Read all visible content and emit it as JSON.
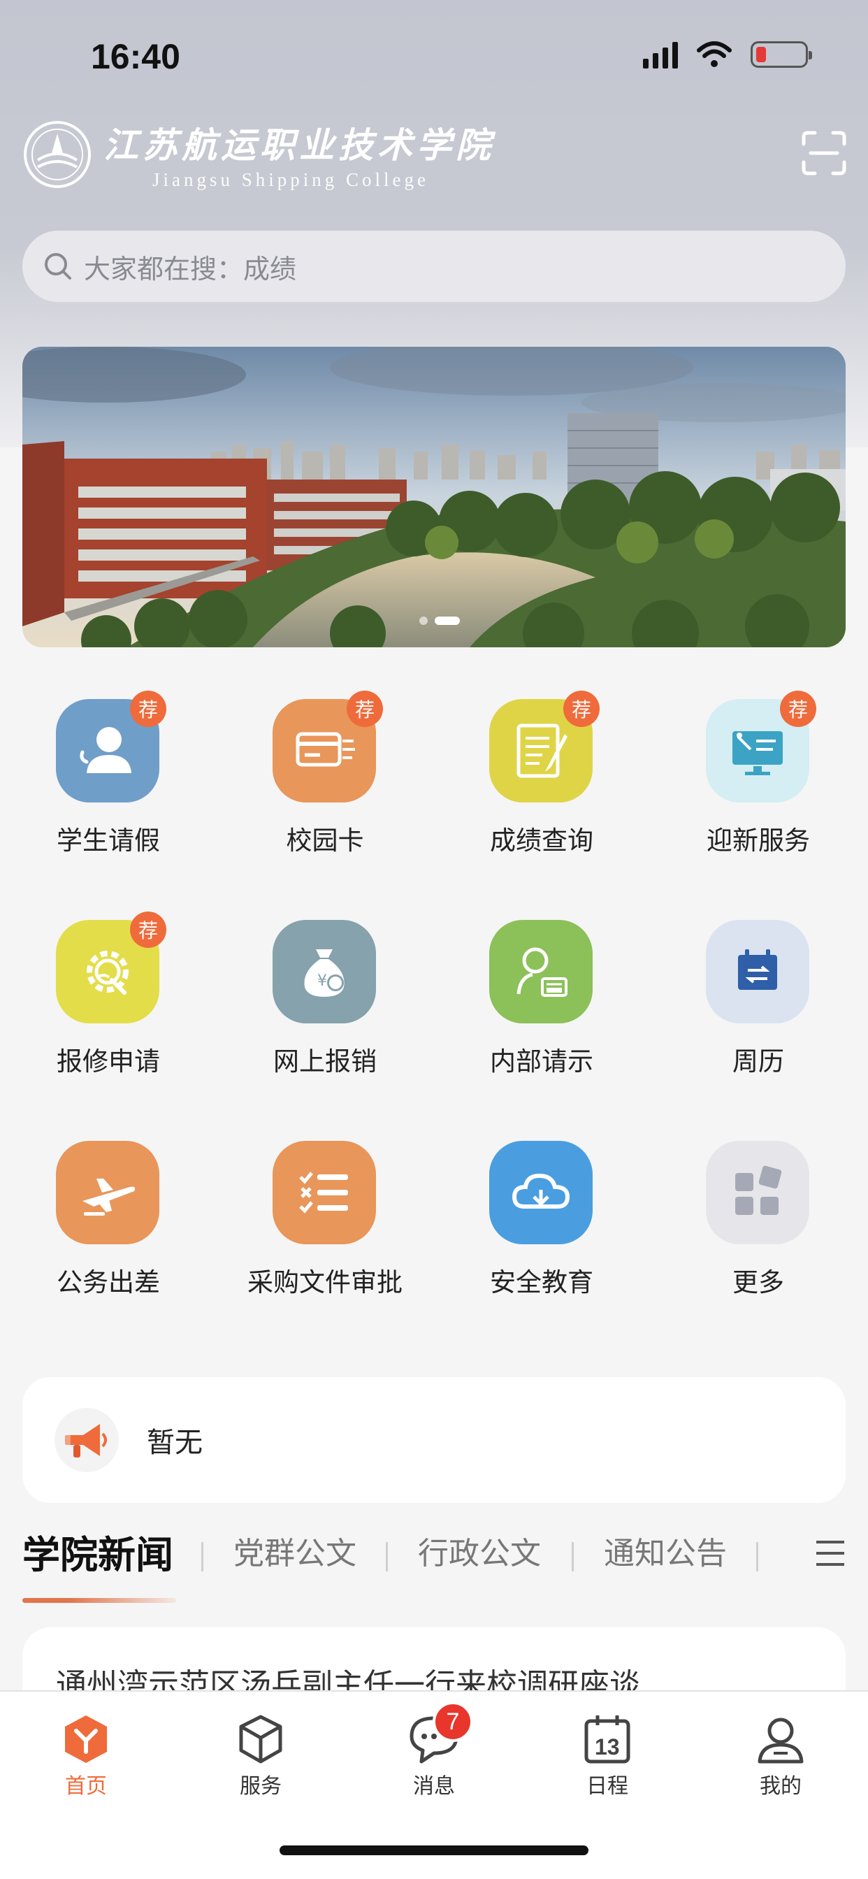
{
  "status_bar": {
    "time": "16:40"
  },
  "header": {
    "school_name_cn": "江苏航运职业技术学院",
    "school_name_en": "Jiangsu Shipping College",
    "logo_icon": "school-emblem-icon",
    "scan_icon": "scan-icon"
  },
  "search": {
    "placeholder": "大家都在搜：成绩"
  },
  "banner": {
    "slide_count": 2,
    "active_slide": 2
  },
  "services": {
    "recommend_badge": "荐",
    "items": [
      {
        "label": "学生请假",
        "icon": "user-leave-icon",
        "color": "#6f9ec9",
        "recommended": true
      },
      {
        "label": "校园卡",
        "icon": "campus-card-icon",
        "color": "#e8965a",
        "recommended": true
      },
      {
        "label": "成绩查询",
        "icon": "grade-document-icon",
        "color": "#dfd446",
        "recommended": true
      },
      {
        "label": "迎新服务",
        "icon": "welcome-screen-icon",
        "color": "#d4eef3",
        "recommended": true
      },
      {
        "label": "报修申请",
        "icon": "repair-gear-icon",
        "color": "#e3dd4a",
        "recommended": true
      },
      {
        "label": "网上报销",
        "icon": "money-bag-icon",
        "color": "#85a2ad",
        "recommended": false
      },
      {
        "label": "内部请示",
        "icon": "person-search-icon",
        "color": "#8cc059",
        "recommended": false
      },
      {
        "label": "周历",
        "icon": "calendar-icon",
        "color": "#dbe3f1",
        "recommended": false
      },
      {
        "label": "公务出差",
        "icon": "airplane-icon",
        "color": "#e8965a",
        "recommended": false
      },
      {
        "label": "采购文件审批",
        "icon": "checklist-icon",
        "color": "#e8965a",
        "recommended": false
      },
      {
        "label": "安全教育",
        "icon": "cloud-icon",
        "color": "#4a9ee0",
        "recommended": false
      },
      {
        "label": "更多",
        "icon": "more-grid-icon",
        "color": "#e6e6ea",
        "recommended": false
      }
    ]
  },
  "notice": {
    "text": "暂无",
    "icon": "megaphone-icon"
  },
  "news": {
    "tabs": [
      "学院新闻",
      "党群公文",
      "行政公文",
      "通知公告"
    ],
    "active_tab": 0,
    "first_title": "通州湾示范区汤兵副主任一行来校调研座谈"
  },
  "tabbar": {
    "items": [
      {
        "label": "首页",
        "icon": "home-icon",
        "active": true
      },
      {
        "label": "服务",
        "icon": "cube-icon",
        "active": false
      },
      {
        "label": "消息",
        "icon": "chat-icon",
        "active": false,
        "badge": "7"
      },
      {
        "label": "日程",
        "icon": "calendar-13-icon",
        "active": false,
        "day": "13"
      },
      {
        "label": "我的",
        "icon": "profile-icon",
        "active": false
      }
    ]
  },
  "colors": {
    "accent": "#ef6b3b",
    "badge": "#e8362d"
  }
}
